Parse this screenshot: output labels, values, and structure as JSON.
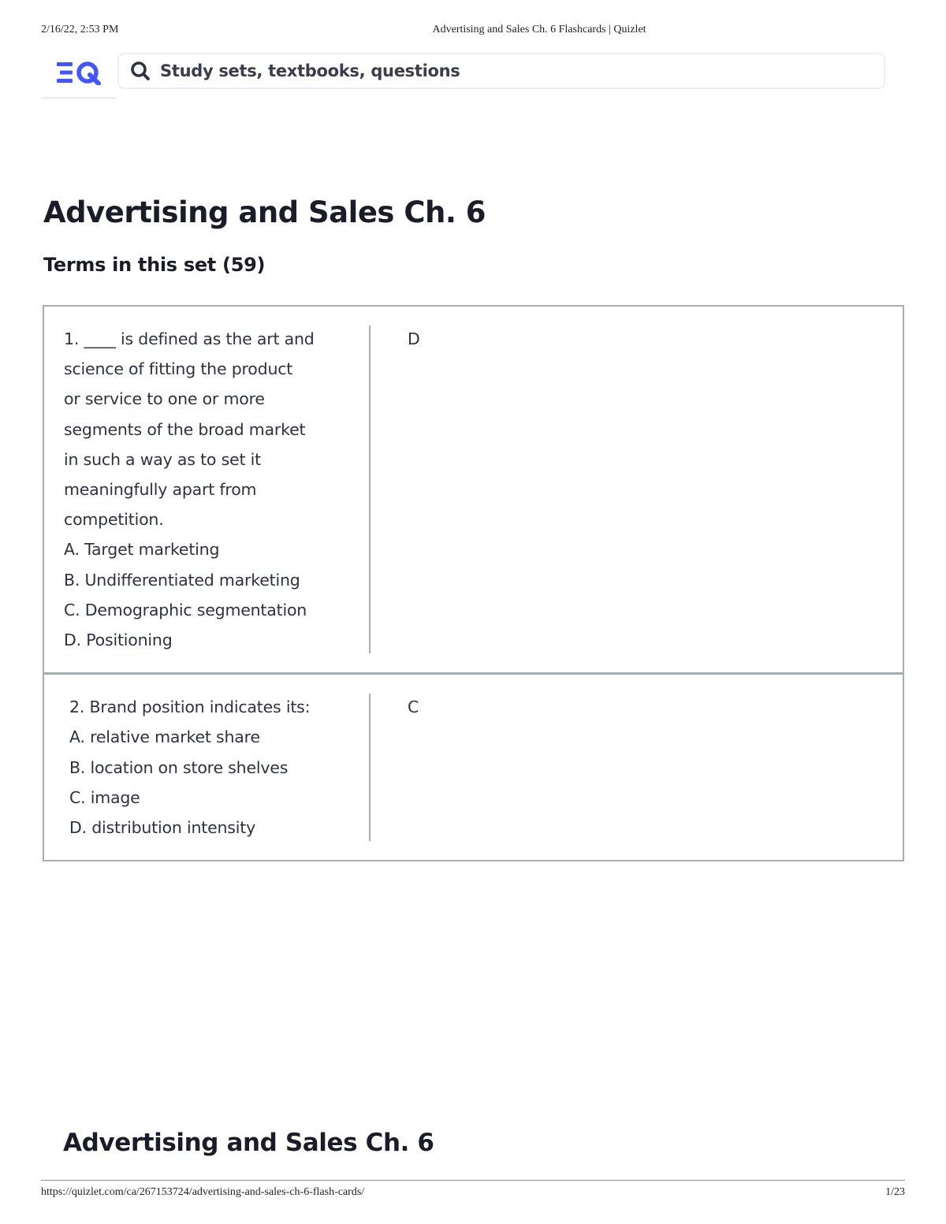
{
  "print_header": {
    "datetime": "2/16/22, 2:53 PM",
    "doc_title": "Advertising and Sales Ch. 6 Flashcards | Quizlet"
  },
  "topbar": {
    "logo_icon": "quizlet-logo-icon",
    "search_placeholder": "Study sets, textbooks, questions"
  },
  "set": {
    "title": "Advertising and Sales Ch. 6",
    "terms_heading": "Terms in this set (59)"
  },
  "terms": [
    {
      "term_lines": [
        "1. ____ is defined as the art and",
        "science of fitting the product",
        "or service to one or more",
        "segments of the broad market",
        "in such a way as to set it",
        "meaningfully apart from",
        "competition.",
        "A. Target marketing",
        "B. Undifferentiated marketing",
        "C. Demographic segmentation",
        "D. Positioning"
      ],
      "definition": "D"
    },
    {
      "term_lines": [
        "2. Brand position indicates its:",
        "A. relative market share",
        "B. location on store shelves",
        "C. image",
        "D. distribution intensity"
      ],
      "definition": "C"
    }
  ],
  "footer": {
    "set_title": "Advertising and Sales Ch. 6",
    "url": "https://quizlet.com/ca/267153724/advertising-and-sales-ch-6-flash-cards/",
    "page": "1/23"
  },
  "colors": {
    "brand_blue": "#4255ff",
    "border": "#a5acbd",
    "text": "#2e3140"
  }
}
